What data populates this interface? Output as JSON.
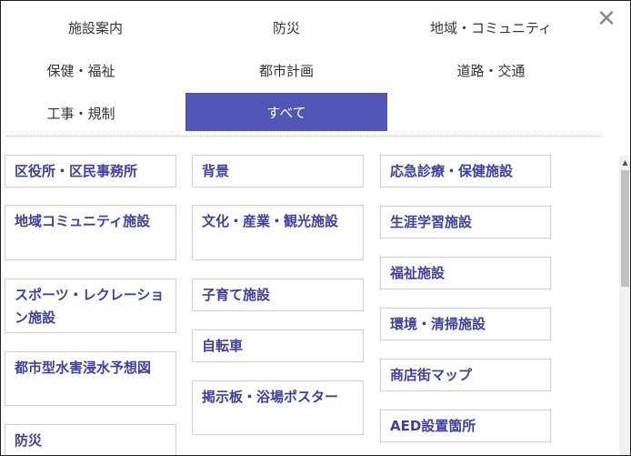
{
  "tabs": [
    {
      "label": "施設案内"
    },
    {
      "label": "防災"
    },
    {
      "label": "地域・コミュニティ"
    },
    {
      "label": "保健・福祉"
    },
    {
      "label": "都市計画"
    },
    {
      "label": "道路・交通"
    },
    {
      "label": "工事・規制"
    },
    {
      "label": "すべて",
      "active": true
    }
  ],
  "close_glyph": "✕",
  "categories": [
    "区役所・区民事務所",
    "背景",
    "応急診療・保健施設",
    "地域コミュニティ施設",
    "文化・産業・観光施設",
    "生涯学習施設",
    "福祉施設",
    "スポーツ・レクレーション施設",
    "子育て施設",
    "環境・清掃施設",
    "自転車",
    "商店街マップ",
    "都市型水害浸水予想図",
    "掲示板・浴場ポスター",
    "AED設置箇所",
    "防災"
  ],
  "accent_color": "#5355b6",
  "link_color": "#3f3fa3"
}
